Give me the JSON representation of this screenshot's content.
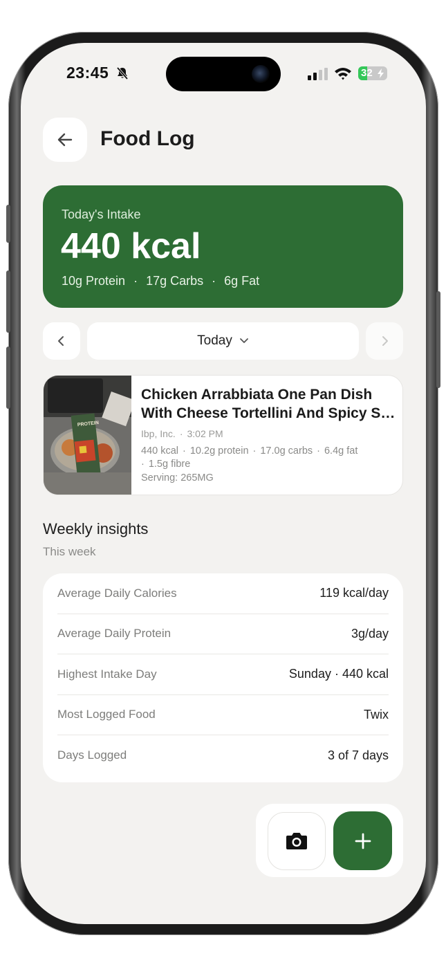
{
  "status_bar": {
    "time": "23:45",
    "battery_percent": "32",
    "battery_level": 0.32,
    "icons": [
      "bell-slash-icon",
      "cellular-signal-icon",
      "wifi-icon",
      "battery-charging-icon"
    ]
  },
  "header": {
    "back_icon": "arrow-left-icon",
    "title": "Food Log"
  },
  "intake": {
    "label": "Today's Intake",
    "kcal": "440 kcal",
    "protein": "10g Protein",
    "carbs": "17g Carbs",
    "fat": "6g Fat",
    "separator": "·",
    "color": "#2d6d34"
  },
  "date_selector": {
    "prev_icon": "chevron-left-icon",
    "label": "Today",
    "dropdown_icon": "chevron-down-icon",
    "next_icon": "chevron-right-icon"
  },
  "food_entry": {
    "name_line1": "Chicken Arrabbiata One Pan Dish",
    "name_line2": "With Cheese Tortellini And Spicy Sauce",
    "brand": "Ibp, Inc.",
    "time": "3:02 PM",
    "kcal": "440 kcal",
    "protein": "10.2g protein",
    "carbs": "17.0g carbs",
    "fat": "6.4g fat",
    "fibre": "1.5g fibre",
    "serving": "Serving: 265MG",
    "separator": "·",
    "thumb_label": "PROTEIN"
  },
  "insights": {
    "title": "Weekly insights",
    "subtitle": "This week",
    "rows": [
      {
        "label": "Average Daily Calories",
        "value": "119 kcal/day"
      },
      {
        "label": "Average Daily Protein",
        "value": "3g/day"
      },
      {
        "label": "Highest Intake Day",
        "value": "Sunday · 440 kcal"
      },
      {
        "label": "Most Logged Food",
        "value": "Twix"
      },
      {
        "label": "Days Logged",
        "value": "3 of 7 days"
      }
    ]
  },
  "actions": {
    "camera_icon": "camera-icon",
    "add_icon": "plus-icon",
    "accent": "#2d6d34"
  }
}
